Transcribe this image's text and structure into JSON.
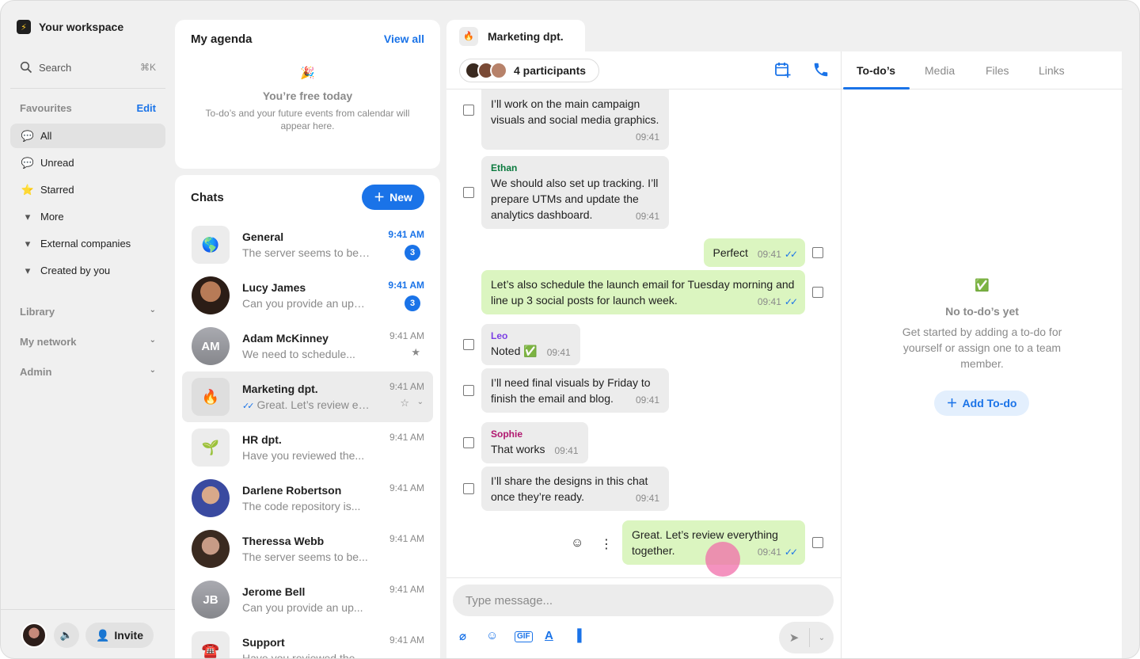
{
  "workspace": {
    "name": "Your workspace",
    "logo_icon": "bolt-icon"
  },
  "search": {
    "label": "Search",
    "shortcut": "⌘K"
  },
  "favourites": {
    "title": "Favourites",
    "edit_label": "Edit",
    "items": [
      {
        "label": "All",
        "icon": "chat-bubble-icon"
      },
      {
        "label": "Unread",
        "icon": "chat-unread-icon"
      },
      {
        "label": "Starred",
        "icon": "star-icon"
      },
      {
        "label": "More",
        "icon": "caret-down-icon"
      },
      {
        "label": "External companies",
        "icon": "caret-down-icon"
      },
      {
        "label": "Created by you",
        "icon": "caret-down-icon"
      }
    ]
  },
  "sections": [
    {
      "label": "Library"
    },
    {
      "label": "My network"
    },
    {
      "label": "Admin"
    }
  ],
  "footer": {
    "invite_label": "Invite"
  },
  "agenda": {
    "title": "My agenda",
    "view_all": "View all",
    "empty_emoji": "🎉",
    "empty_title": "You’re free today",
    "empty_subtitle": "To-do’s and your future events from calendar will appear here."
  },
  "chats": {
    "title": "Chats",
    "new_label": "New",
    "rows": [
      {
        "name": "General",
        "preview": "The server seems to be down",
        "time": "9:41 AM",
        "badge": "3",
        "avatar": "🌎"
      },
      {
        "name": "Lucy James",
        "preview": "Can you provide an update",
        "time": "9:41 AM",
        "badge": "3"
      },
      {
        "name": "Adam McKinney",
        "preview": "We need to schedule...",
        "time": "9:41 AM",
        "initials": "AM"
      },
      {
        "name": "Marketing dpt.",
        "preview": "Great. Let’s review everything together.",
        "time": "9:41 AM",
        "avatar": "🔥"
      },
      {
        "name": "HR dpt.",
        "preview": "Have you reviewed the...",
        "time": "9:41 AM",
        "avatar": "🌱"
      },
      {
        "name": "Darlene Robertson",
        "preview": "The code repository is...",
        "time": "9:41 AM"
      },
      {
        "name": "Theressa Webb",
        "preview": "The server seems to be...",
        "time": "9:41 AM"
      },
      {
        "name": "Jerome Bell",
        "preview": "Can you provide an up...",
        "time": "9:41 AM",
        "initials": "JB"
      },
      {
        "name": "Support",
        "preview": "Have you reviewed the...",
        "time": "9:41 AM",
        "avatar": "☎️"
      }
    ]
  },
  "conversation": {
    "tab_title": "Marketing dpt.",
    "tab_icon": "🔥",
    "participants": "4 participants",
    "messages": [
      {
        "text": "I’ll work on the main campaign visuals and social media graphics.",
        "time": "09:41"
      },
      {
        "sender": "Ethan",
        "sender_color": "#0b7a3e",
        "text": "We should also set up tracking. I’ll prepare UTMs and update the analytics dashboard.",
        "time": "09:41"
      },
      {
        "text": "Perfect",
        "time": "09:41",
        "ticks": "✓✓"
      },
      {
        "text": "Let’s also schedule the launch email for Tuesday morning and line up 3 social posts for launch week.",
        "time": "09:41",
        "ticks": "✓✓"
      },
      {
        "sender": "Leo",
        "sender_color": "#7b3fe4",
        "text": "Noted ✅",
        "time": "09:41"
      },
      {
        "text": "I’ll need final visuals by Friday to finish the email and blog.",
        "time": "09:41"
      },
      {
        "sender": "Sophie",
        "sender_color": "#b0176f",
        "text": "That works",
        "time": "09:41"
      },
      {
        "text": "I’ll share the designs in this chat once they’re ready.",
        "time": "09:41"
      },
      {
        "text": "Great. Let’s review everything together.",
        "time": "09:41",
        "ticks": "✓✓"
      }
    ],
    "composer": {
      "placeholder": "Type message..."
    }
  },
  "panel": {
    "tabs": [
      "To-do’s",
      "Media",
      "Files",
      "Links"
    ],
    "empty_emoji": "✅",
    "empty_title": "No to-do’s yet",
    "empty_subtitle": "Get started by adding a to-do for yourself or assign one to a team member.",
    "add_label": "Add To-do"
  },
  "colors": {
    "accent": "#1a73e8",
    "outgoing_bubble": "#dbf5c0",
    "incoming_bubble": "#ececec"
  }
}
